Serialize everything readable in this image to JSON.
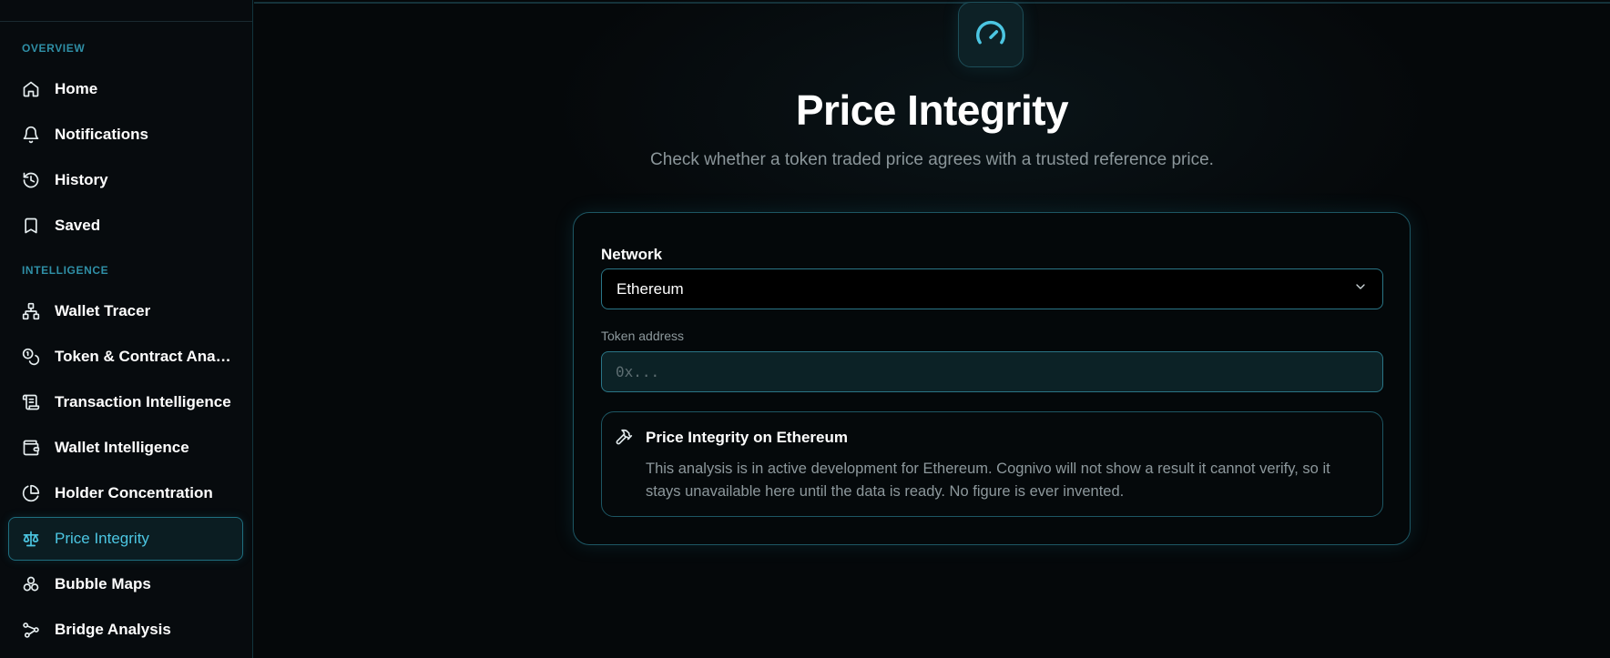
{
  "sidebar": {
    "sections": [
      {
        "label": "OVERVIEW"
      },
      {
        "label": "INTELLIGENCE"
      }
    ],
    "items": [
      {
        "label": "Home",
        "icon": "home-icon"
      },
      {
        "label": "Notifications",
        "icon": "bell-icon"
      },
      {
        "label": "History",
        "icon": "history-icon"
      },
      {
        "label": "Saved",
        "icon": "bookmark-icon"
      },
      {
        "label": "Wallet Tracer",
        "icon": "network-icon"
      },
      {
        "label": "Token & Contract Analysis",
        "icon": "coins-icon"
      },
      {
        "label": "Transaction Intelligence",
        "icon": "scroll-icon"
      },
      {
        "label": "Wallet Intelligence",
        "icon": "wallet-icon"
      },
      {
        "label": "Holder Concentration",
        "icon": "pie-chart-icon"
      },
      {
        "label": "Price Integrity",
        "icon": "scale-icon",
        "active": true
      },
      {
        "label": "Bubble Maps",
        "icon": "bubbles-icon"
      },
      {
        "label": "Bridge Analysis",
        "icon": "bridge-icon"
      }
    ]
  },
  "header": {
    "logo_icon": "gauge-icon",
    "title": "Price Integrity",
    "subtitle": "Check whether a token traded price agrees with a trusted reference price."
  },
  "form": {
    "network_label": "Network",
    "network_value": "Ethereum",
    "token_label": "Token address",
    "token_placeholder": "0x..."
  },
  "notice": {
    "icon": "hammer-icon",
    "title": "Price Integrity on Ethereum",
    "body": "This analysis is in active development for Ethereum. Cognivo will not show a result it cannot verify, so it stays unavailable here until the data is ready. No figure is ever invented."
  },
  "colors": {
    "accent": "#4cc6e2",
    "section_label": "#2f8fa6",
    "border": "#1d5663",
    "background": "#05080a"
  }
}
